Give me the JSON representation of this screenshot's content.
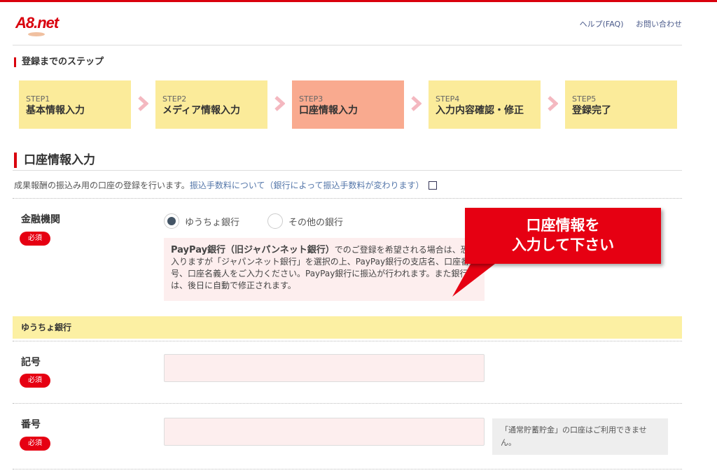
{
  "header": {
    "logo": "A8.net",
    "links": [
      "ヘルプ(FAQ)",
      "お問い合わせ"
    ]
  },
  "steps": {
    "title": "登録までのステップ",
    "items": [
      {
        "num": "STEP1",
        "label": "基本情報入力"
      },
      {
        "num": "STEP2",
        "label": "メディア情報入力"
      },
      {
        "num": "STEP3",
        "label": "口座情報入力"
      },
      {
        "num": "STEP4",
        "label": "入力内容確認・修正"
      },
      {
        "num": "STEP5",
        "label": "登録完了"
      }
    ],
    "active_index": 2
  },
  "section": {
    "title": "口座情報入力",
    "description": "成果報酬の振込み用の口座の登録を行います。",
    "fee_link": "振込手数料について（銀行によって振込手数料が変わります）"
  },
  "financial": {
    "label": "金融機関",
    "required": "必須",
    "options": [
      "ゆうちょ銀行",
      "その他の銀行"
    ],
    "selected": "ゆうちょ銀行",
    "notice_bold": "PayPay銀行（旧ジャパンネット銀行）",
    "notice_text": "でのご登録を希望される場合は、恐れ入りますが「ジャパンネット銀行」を選択の上、PayPay銀行の支店名、口座番号、口座名義人をご入力ください。PayPay銀行に振込が行われます。また銀行名は、後日に自動で修正されます。"
  },
  "callout": {
    "line1": "口座情報を",
    "line2": "入力して下さい"
  },
  "yucho": {
    "title": "ゆうちょ銀行",
    "kigo_label": "記号",
    "kigo_value": "",
    "bango_label": "番号",
    "bango_value": "",
    "required": "必須",
    "hint": "「通常貯蓄貯金」の口座はご利用できません。"
  },
  "colors": {
    "brand_red": "#d9000d",
    "step_bg": "#fbeb9a",
    "step_active_bg": "#f9aa8f",
    "input_bg": "#fdeeee",
    "subheader_bg": "#fcf0a3"
  }
}
